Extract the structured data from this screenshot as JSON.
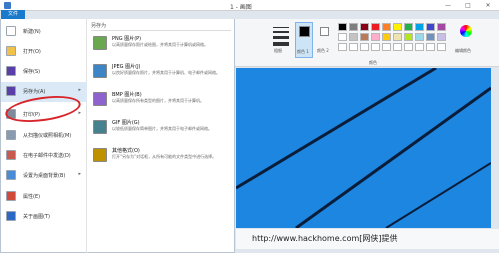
{
  "window": {
    "title": "1 - 画图",
    "file_tab": "文件",
    "minimize": "—",
    "maximize": "□",
    "close": "✕"
  },
  "file_menu": {
    "items": [
      {
        "label": "新建(N)",
        "icon": "new-file-icon",
        "color": "#ffffff"
      },
      {
        "label": "打开(O)",
        "icon": "open-folder-icon",
        "color": "#f1c24b"
      },
      {
        "label": "保存(S)",
        "icon": "save-disk-icon",
        "color": "#5b3fa8"
      },
      {
        "label": "另存为(A)",
        "icon": "save-as-icon",
        "color": "#5b3fa8",
        "has_submenu": true
      },
      {
        "label": "打印(P)",
        "icon": "print-icon",
        "color": "#7d8a99",
        "has_submenu": true
      },
      {
        "label": "从扫描仪或照相机(M)",
        "icon": "scanner-icon",
        "color": "#8a9bb0"
      },
      {
        "label": "在电子邮件中发送(D)",
        "icon": "email-icon",
        "color": "#c85a50"
      },
      {
        "label": "设置为桌面背景(B)",
        "icon": "desktop-background-icon",
        "color": "#4a8bd6",
        "has_submenu": true
      },
      {
        "label": "属性(E)",
        "icon": "properties-check-icon",
        "color": "#d04a3a"
      },
      {
        "label": "关于画图(T)",
        "icon": "about-info-icon",
        "color": "#2c68c4"
      }
    ],
    "save_as_heading": "另存为",
    "formats": [
      {
        "title": "PNG 图片(P)",
        "desc": "以高质量保存照片或绘图，并将其用于计算机或网络。",
        "icon": "png-file-icon",
        "color": "#6aa84f"
      },
      {
        "title": "JPEG 图片(J)",
        "desc": "以良好质量保存照片，并将其用于计算机、电子邮件或网络。",
        "icon": "jpeg-file-icon",
        "color": "#3d85c6"
      },
      {
        "title": "BMP 图片(B)",
        "desc": "以高质量保存所有类型的图片，并将其用于计算机。",
        "icon": "bmp-file-icon",
        "color": "#8e63ce"
      },
      {
        "title": "GIF 图片(G)",
        "desc": "以较低质量保存简单图片，并将其用于电子邮件或网络。",
        "icon": "gif-file-icon",
        "color": "#45818e"
      },
      {
        "title": "其他格式(O)",
        "desc": "打开“另存为”对话框，从所有可能的文件类型中进行选择。",
        "icon": "other-formats-icon",
        "color": "#bf9000"
      }
    ]
  },
  "ribbon": {
    "thickness_label": "粗细",
    "color1_label": "颜色 1",
    "color2_label": "颜色 2",
    "edit_colors_label": "编辑颜色",
    "colors_group_label": "颜色",
    "palette_row1": [
      "#000000",
      "#7f7f7f",
      "#880015",
      "#ed1c24",
      "#ff7f27",
      "#fff200",
      "#22b14c",
      "#00a2e8",
      "#3f48cc",
      "#a349a4"
    ],
    "palette_row2": [
      "#ffffff",
      "#c3c3c3",
      "#b97a57",
      "#ffaec9",
      "#ffc90e",
      "#efe4b0",
      "#b5e61d",
      "#99d9ea",
      "#7092be",
      "#c8bfe7"
    ],
    "accent": "#1979ca"
  },
  "canvas": {
    "background": "#1d86e0"
  },
  "watermark": {
    "text": "http://www.hackhome.com[网侠]提供"
  }
}
